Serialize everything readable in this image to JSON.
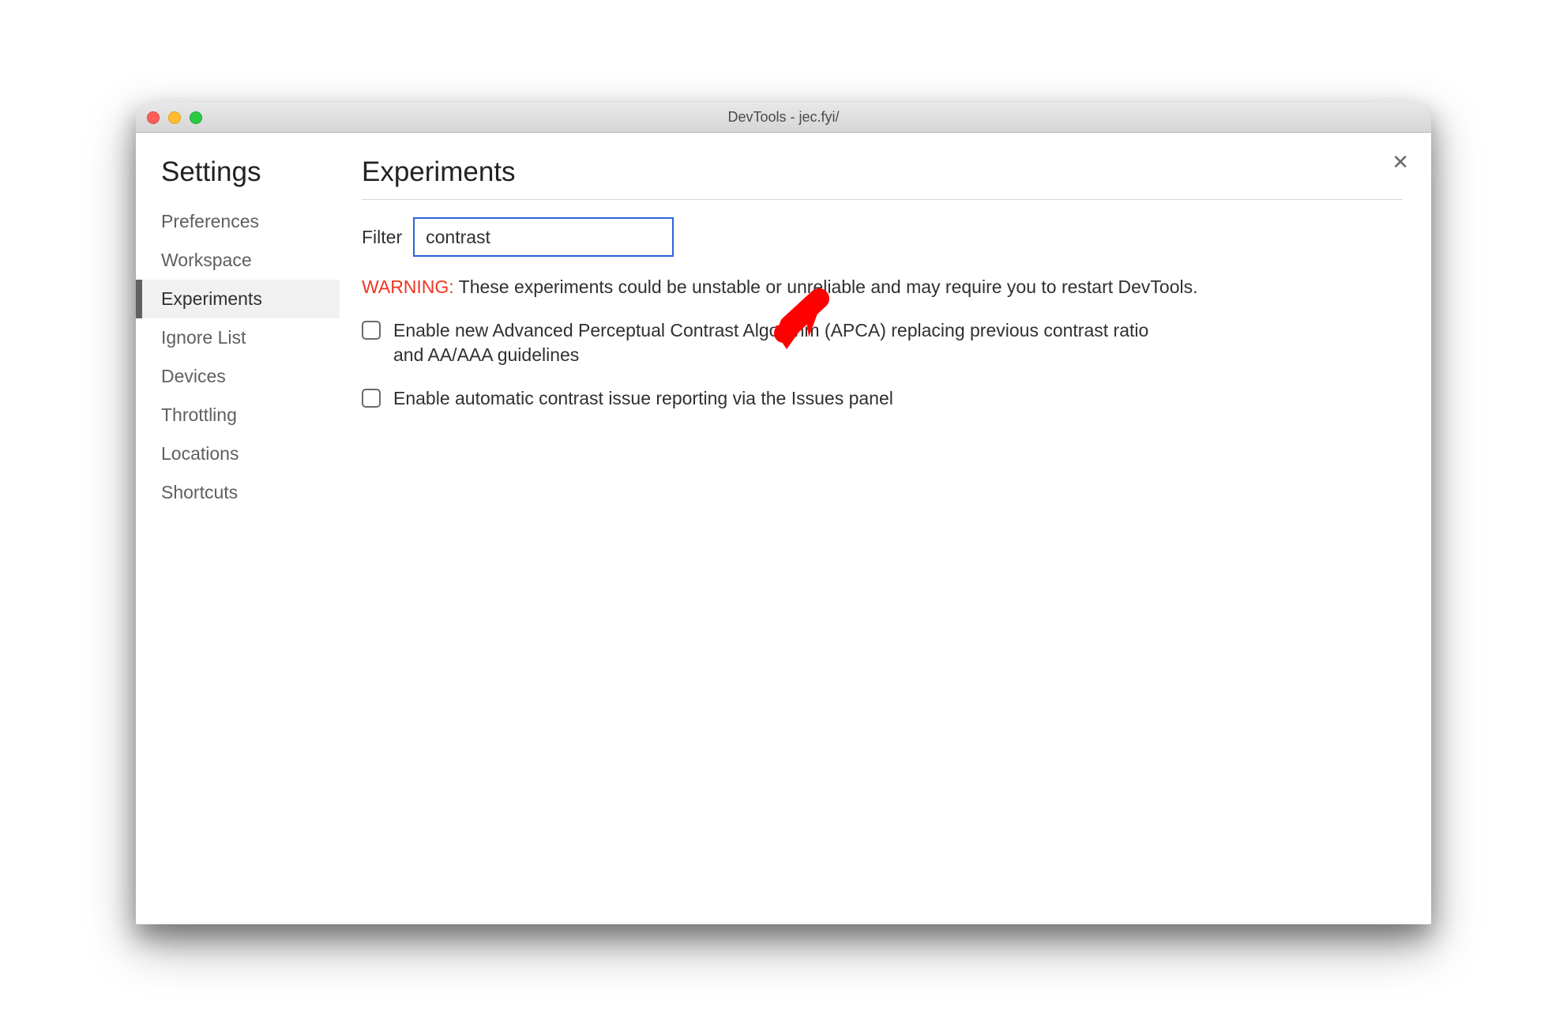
{
  "window": {
    "title": "DevTools - jec.fyi/"
  },
  "sidebar": {
    "title": "Settings",
    "items": [
      {
        "label": "Preferences",
        "active": false
      },
      {
        "label": "Workspace",
        "active": false
      },
      {
        "label": "Experiments",
        "active": true
      },
      {
        "label": "Ignore List",
        "active": false
      },
      {
        "label": "Devices",
        "active": false
      },
      {
        "label": "Throttling",
        "active": false
      },
      {
        "label": "Locations",
        "active": false
      },
      {
        "label": "Shortcuts",
        "active": false
      }
    ]
  },
  "main": {
    "title": "Experiments",
    "filter": {
      "label": "Filter",
      "value": "contrast"
    },
    "warning": {
      "prefix": "WARNING:",
      "text": " These experiments could be unstable or unreliable and may require you to restart DevTools."
    },
    "experiments": [
      {
        "label": "Enable new Advanced Perceptual Contrast Algorithm (APCA) replacing previous contrast ratio and AA/AAA guidelines",
        "checked": false
      },
      {
        "label": "Enable automatic contrast issue reporting via the Issues panel",
        "checked": false
      }
    ]
  },
  "closeGlyph": "✕"
}
